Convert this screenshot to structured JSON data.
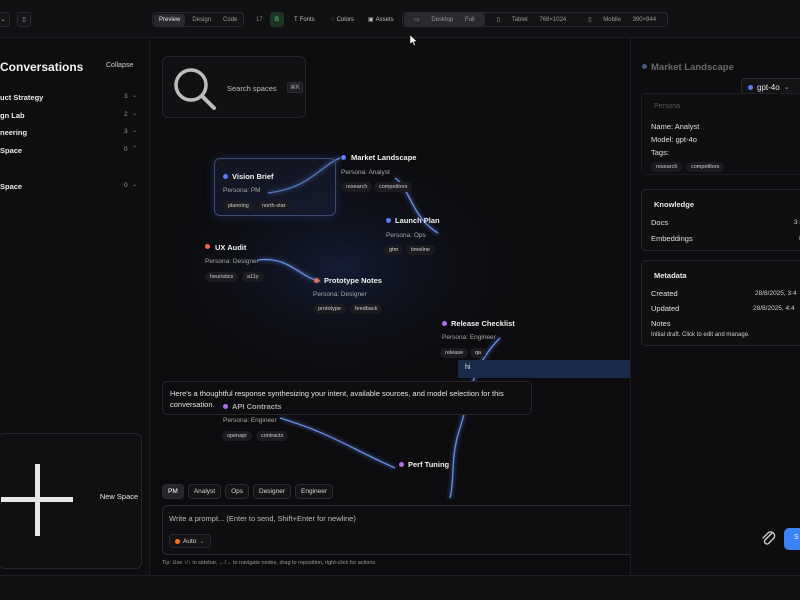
{
  "toolbar": {
    "modes": [
      "Preview",
      "Design",
      "Code"
    ],
    "active_mode": "Preview",
    "counter": "17",
    "badge": "B",
    "fonts": "Fonts",
    "colors": "Colors",
    "assets": "Assets",
    "devices": [
      {
        "label": "Desktop",
        "size": "Full"
      },
      {
        "label": "Tablet",
        "size": "768×1024"
      },
      {
        "label": "Mobile",
        "size": "390×844"
      }
    ]
  },
  "sidebar": {
    "title": "Conversations",
    "collapse_label": "Collapse",
    "spaces": [
      {
        "label": "uct Strategy",
        "count": "3",
        "chevron": "⌄"
      },
      {
        "label": "gn Lab",
        "count": "2",
        "chevron": "⌄"
      },
      {
        "label": "neering",
        "count": "3",
        "chevron": "⌄"
      },
      {
        "label": "Space",
        "count": "0",
        "chevron": "⌃"
      },
      {
        "label": "Space",
        "count": "0",
        "chevron": "⌄"
      }
    ],
    "new_space_label": "New Space"
  },
  "search": {
    "label": "Search spaces",
    "shortcut": "⌘K"
  },
  "nodes": [
    {
      "title": "Vision Brief",
      "persona": "Persona: PM",
      "tags": [
        "planning",
        "north-star"
      ],
      "color": "#5b7cf5"
    },
    {
      "title": "Market Landscape",
      "persona": "Persona: Analyst",
      "tags": [
        "research",
        "competitors"
      ],
      "color": "#5b7cf5"
    },
    {
      "title": "Launch Plan",
      "persona": "Persona: Ops",
      "tags": [
        "gtm",
        "timeline"
      ],
      "color": "#5b7cf5"
    },
    {
      "title": "UX Audit",
      "persona": "Persona: Designer",
      "tags": [
        "heuristics",
        "a11y"
      ],
      "color": "#f06b4a"
    },
    {
      "title": "Prototype Notes",
      "persona": "Persona: Designer",
      "tags": [
        "prototype",
        "feedback"
      ],
      "color": "#f06b4a"
    },
    {
      "title": "Release Checklist",
      "persona": "Persona: Engineer",
      "tags": [
        "release",
        "qa"
      ],
      "color": "#b06ef0"
    },
    {
      "title": "API Contracts",
      "persona": "Persona: Engineer",
      "tags": [
        "openapi",
        "contracts"
      ],
      "color": "#b06ef0"
    },
    {
      "title": "Perf Tuning",
      "persona": "",
      "tags": [],
      "color": "#b06ef0"
    }
  ],
  "chat": {
    "user_message": "hi",
    "assistant_message": "Here's a thoughtful response synthesizing your intent, available sources, and model selection for this conversation."
  },
  "personas": [
    "PM",
    "Analyst",
    "Ops",
    "Designer",
    "Engineer"
  ],
  "active_persona": "PM",
  "prompt": {
    "placeholder": "Write a prompt... (Enter to send, Shift+Enter for newline)",
    "auto_label": "Auto",
    "tip": "Tip: Use ↑/↓ in sidebar, ←/→ to navigate nodes, drag to reposition, right-click for actions."
  },
  "right_panel": {
    "title": "Market Landscape",
    "model": "gpt-4o",
    "persona_header": "Persona",
    "name_line": "Name:  Analyst",
    "model_line": "Model:  gpt-4o",
    "tags_label": "Tags:",
    "tags": [
      "research",
      "competitors"
    ],
    "knowledge": {
      "header": "Knowledge",
      "docs_label": "Docs",
      "docs_value": "3 s",
      "embeddings_label": "Embeddings",
      "embeddings_value": "8"
    },
    "metadata": {
      "header": "Metadata",
      "created_label": "Created",
      "created_value": "28/8/2025, 3:4",
      "updated_label": "Updated",
      "updated_value": "28/8/2025, 4:4",
      "notes_label": "Notes",
      "notes_value": "Initial draft. Click to edit and manage."
    }
  },
  "colors": {
    "accent": "#3b82f6",
    "send_button": "#3b82f6"
  }
}
